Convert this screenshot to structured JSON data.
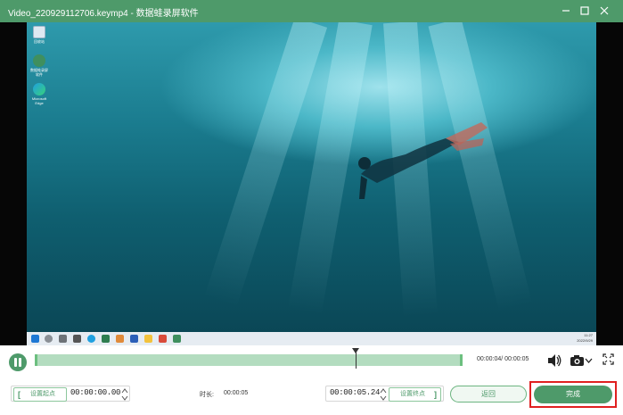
{
  "window": {
    "title": "Video_220929112706.keymp4  -  数据蛙录屏软件"
  },
  "desktop": {
    "icons": [
      {
        "label": "回收站"
      },
      {
        "label": "数据蛙录屏软件"
      },
      {
        "label": "Microsoft Edge"
      }
    ],
    "taskbar_clock": {
      "time": "11:27",
      "date": "2022/9/29"
    }
  },
  "player": {
    "time_display": "00:00:04/ 00:00:05",
    "progress_fraction": 0.75
  },
  "trim": {
    "set_start_label": "设置起点",
    "start_time": "00:00:00.00",
    "duration_label": "时长:",
    "duration_value": "00:00:05",
    "end_time": "00:00:05.24",
    "set_end_label": "设置终点"
  },
  "actions": {
    "back_label": "返回",
    "done_label": "完成"
  },
  "colors": {
    "brand": "#4e9a6a",
    "track": "#b3dcbf",
    "highlight": "#e02020"
  }
}
